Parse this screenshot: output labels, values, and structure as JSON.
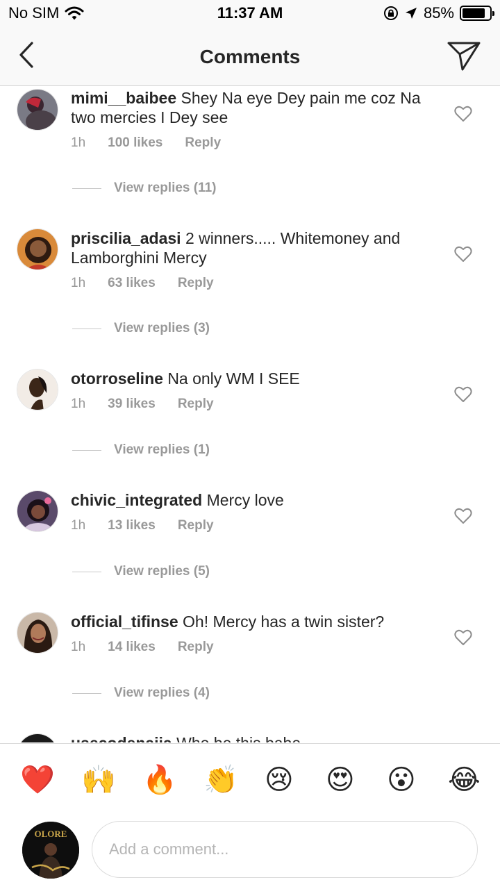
{
  "status_bar": {
    "carrier": "No SIM",
    "time": "11:37 AM",
    "battery": "85%",
    "battery_level": 0.85
  },
  "nav": {
    "title": "Comments"
  },
  "comments": [
    {
      "user": "mimi__baibee",
      "text": "Shey Na eye Dey pain me coz Na two mercies I Dey see",
      "time": "1h",
      "likes": "100 likes",
      "reply": "Reply",
      "view_replies": "View replies (11)"
    },
    {
      "user": "priscilia_adasi",
      "text": "2 winners..... Whitemoney and Lamborghini Mercy",
      "time": "1h",
      "likes": "63 likes",
      "reply": "Reply",
      "view_replies": "View replies (3)"
    },
    {
      "user": "otorroseline",
      "text": "Na only WM I SEE",
      "time": "1h",
      "likes": "39 likes",
      "reply": "Reply",
      "view_replies": "View replies (1)"
    },
    {
      "user": "chivic_integrated",
      "text": "Mercy love",
      "time": "1h",
      "likes": "13 likes",
      "reply": "Reply",
      "view_replies": "View replies (5)"
    },
    {
      "user": "official_tifinse",
      "text": "Oh! Mercy has a twin sister?",
      "time": "1h",
      "likes": "14 likes",
      "reply": "Reply",
      "view_replies": "View replies (4)"
    },
    {
      "user": "usecodenaija",
      "text": "Who be this babe"
    }
  ],
  "reactions": [
    "❤️",
    "🙌",
    "🔥",
    "👏",
    "😢",
    "😍",
    "😮",
    "😂"
  ],
  "composer": {
    "placeholder": "Add a comment...",
    "avatar_text": "OLORE"
  }
}
